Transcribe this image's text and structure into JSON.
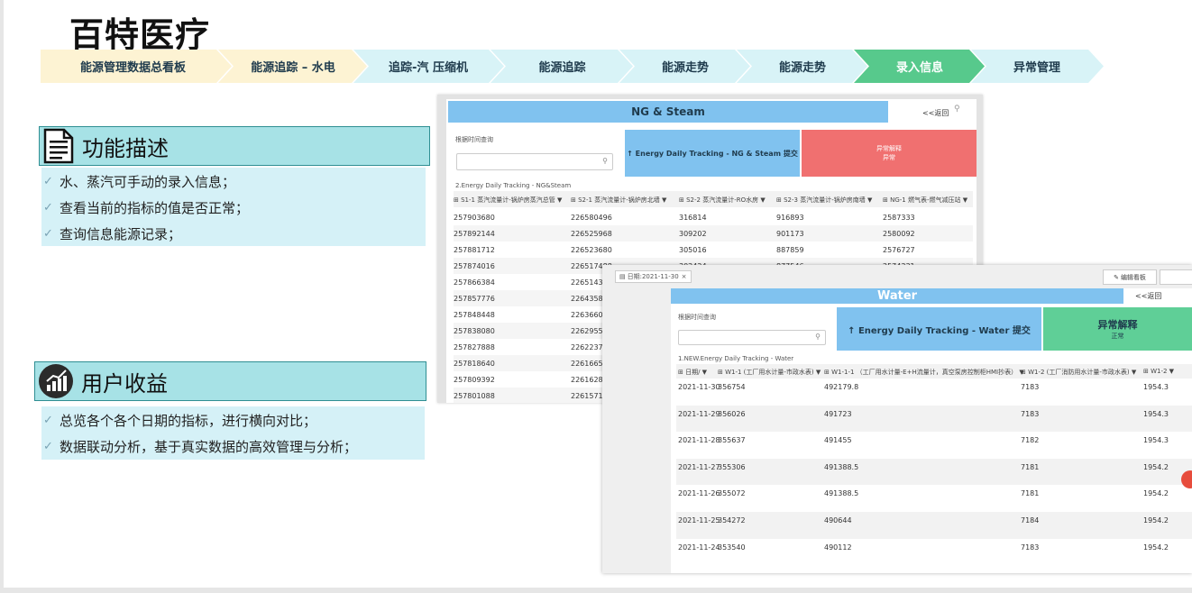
{
  "company": "百特医疗",
  "steps": [
    {
      "label": "能源管理数据总看板",
      "color": "#fdf3d3"
    },
    {
      "label": "能源追踪 – 水电",
      "color": "#fdf3d3"
    },
    {
      "label": "追踪-汽 压缩机",
      "color": "#d8f3f7"
    },
    {
      "label": "能源追踪",
      "color": "#d8f3f7"
    },
    {
      "label": "能源走势",
      "color": "#d8f3f7"
    },
    {
      "label": "能源走势",
      "color": "#d8f3f7"
    },
    {
      "label": "录入信息",
      "color": "#57c98c"
    },
    {
      "label": "异常管理",
      "color": "#d8f3f7"
    }
  ],
  "section1": {
    "title": "功能描述",
    "items": [
      "水、蒸汽可手动的录入信息；",
      "查看当前的指标的值是否正常；",
      "查询信息能源记录；"
    ]
  },
  "section2": {
    "title": "用户收益",
    "items": [
      "总览各个各个日期的指标，进行横向对比；",
      "数据联动分析，基于真实数据的高效管理与分析；"
    ]
  },
  "shot1": {
    "title": "NG & Steam",
    "back": "<<返回",
    "query_label": "根据时间查询",
    "submit": "↑ Energy Daily Tracking - NG & Steam 提交",
    "anomaly_line1": "异常解释",
    "anomaly_line2": "异常",
    "table_title": "2.Energy Daily Tracking - NG&Steam",
    "columns": [
      "S1-1 蒸汽流量计-锅炉房蒸汽总管",
      "S2-1 蒸汽流量计-锅炉房北墙",
      "S2-2 蒸汽流量计-RO水房",
      "S2-3 蒸汽流量计-锅炉房南墙",
      "NG-1 燃气表-燃气减压站"
    ],
    "rows": [
      [
        "257903680",
        "226580496",
        "316814",
        "916893",
        "2587333"
      ],
      [
        "257892144",
        "226525968",
        "309202",
        "901173",
        "2580092"
      ],
      [
        "257881712",
        "226523680",
        "305016",
        "887859",
        "2576727"
      ],
      [
        "257874016",
        "226517488",
        "302424",
        "877546",
        "2574331"
      ],
      [
        "257866384",
        "22651432",
        "",
        "",
        ""
      ],
      [
        "257857776",
        "22643580",
        "",
        "",
        ""
      ],
      [
        "257848448",
        "22636603",
        "",
        "",
        ""
      ],
      [
        "257838080",
        "22629552",
        "",
        "",
        ""
      ],
      [
        "257827888",
        "22622371",
        "",
        "",
        ""
      ],
      [
        "257818640",
        "22616656",
        "",
        "",
        ""
      ],
      [
        "257809392",
        "22616289",
        "",
        "",
        ""
      ],
      [
        "257801088",
        "22615718",
        "",
        "",
        ""
      ]
    ]
  },
  "shot2": {
    "filter_chip": "日期:2021-11-30",
    "edit_button": "编辑看板",
    "title": "Water",
    "back": "<<返回",
    "query_label": "根据时间查询",
    "submit": "↑ Energy Daily Tracking - Water 提交",
    "anomaly_line1": "异常解释",
    "anomaly_line2": "正常",
    "table_title": "1.NEW.Energy Daily Tracking - Water",
    "columns": [
      "日期/",
      "W1-1 (工厂用水计量-市政水表)",
      "W1-1-1 （工厂用水计量-E+H流量计，真空泵房控制柜HMI抄表）",
      "W1-2 (工厂消防用水计量-市政水表)",
      "W1-2"
    ],
    "rows": [
      [
        "2021-11-30",
        "356754",
        "492179.8",
        "7183",
        "1954.3"
      ],
      [
        "2021-11-29",
        "356026",
        "491723",
        "7183",
        "1954.3"
      ],
      [
        "2021-11-28",
        "355637",
        "491455",
        "7182",
        "1954.3"
      ],
      [
        "2021-11-27",
        "355306",
        "491388.5",
        "7181",
        "1954.2"
      ],
      [
        "2021-11-26",
        "355072",
        "491388.5",
        "7181",
        "1954.2"
      ],
      [
        "2021-11-25",
        "354272",
        "490644",
        "7184",
        "1954.2"
      ],
      [
        "2021-11-24",
        "353540",
        "490112",
        "7183",
        "1954.2"
      ]
    ]
  }
}
